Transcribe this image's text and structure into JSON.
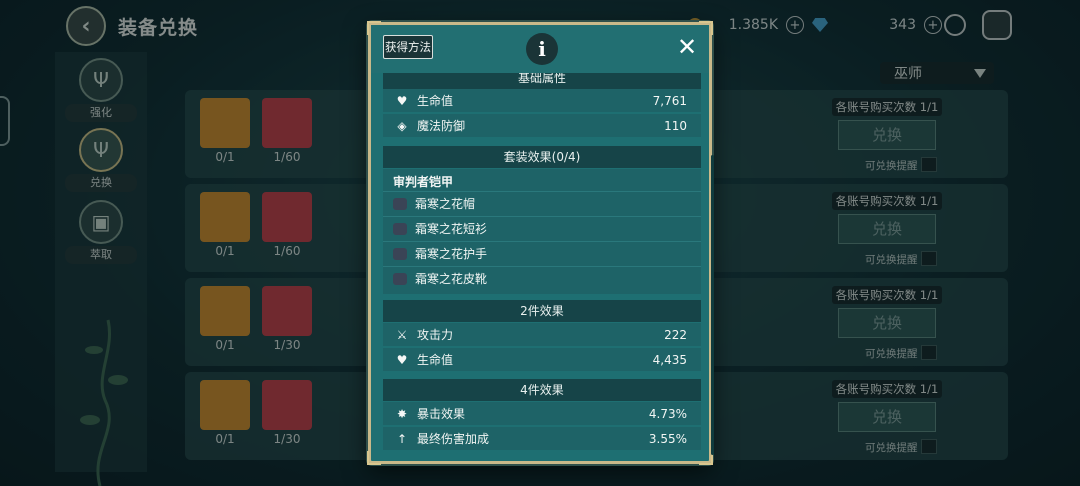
{
  "header": {
    "title": "装备兑换",
    "gold_amount": "1.385K",
    "gem_amount": "343"
  },
  "sidebar": {
    "items": [
      {
        "label": "强化"
      },
      {
        "label": "兑换"
      },
      {
        "label": "萃取"
      }
    ]
  },
  "class_select": {
    "value": "巫师"
  },
  "exchange_rows": [
    {
      "item_count": "0/1",
      "material_count": "1/60",
      "limit": "各账号购买次数 1/1",
      "button": "兑换",
      "remind": "可兑换提醒"
    },
    {
      "item_count": "0/1",
      "material_count": "1/60",
      "limit": "各账号购买次数 1/1",
      "button": "兑换",
      "remind": "可兑换提醒"
    },
    {
      "item_count": "0/1",
      "material_count": "1/30",
      "limit": "各账号购买次数 1/1",
      "button": "兑换",
      "remind": "可兑换提醒"
    },
    {
      "item_count": "0/1",
      "material_count": "1/30",
      "limit": "各账号购买次数 1/1",
      "button": "兑换",
      "remind": "可兑换提醒"
    }
  ],
  "modal": {
    "how_to_get": "获得方法",
    "base_section": "基础属性",
    "base_stats": [
      {
        "icon": "heart-icon",
        "label": "生命值",
        "value": "7,761"
      },
      {
        "icon": "shield-icon",
        "label": "魔法防御",
        "value": "110"
      }
    ],
    "set_section": "套装效果(0/4)",
    "set_name": "审判者铠甲",
    "set_items": [
      {
        "icon": "hat-icon",
        "label": "霜寒之花帽"
      },
      {
        "icon": "shirt-icon",
        "label": "霜寒之花短衫"
      },
      {
        "icon": "gloves-icon",
        "label": "霜寒之花护手"
      },
      {
        "icon": "boots-icon",
        "label": "霜寒之花皮靴"
      }
    ],
    "two_piece_section": "2件效果",
    "two_piece_stats": [
      {
        "icon": "crossed-swords-icon",
        "label": "攻击力",
        "value": "222"
      },
      {
        "icon": "heart-icon",
        "label": "生命值",
        "value": "4,435"
      }
    ],
    "four_piece_section": "4件效果",
    "four_piece_stats": [
      {
        "icon": "crit-icon",
        "label": "暴击效果",
        "value": "4.73%"
      },
      {
        "icon": "damage-up-icon",
        "label": "最终伤害加成",
        "value": "3.55%"
      }
    ]
  }
}
